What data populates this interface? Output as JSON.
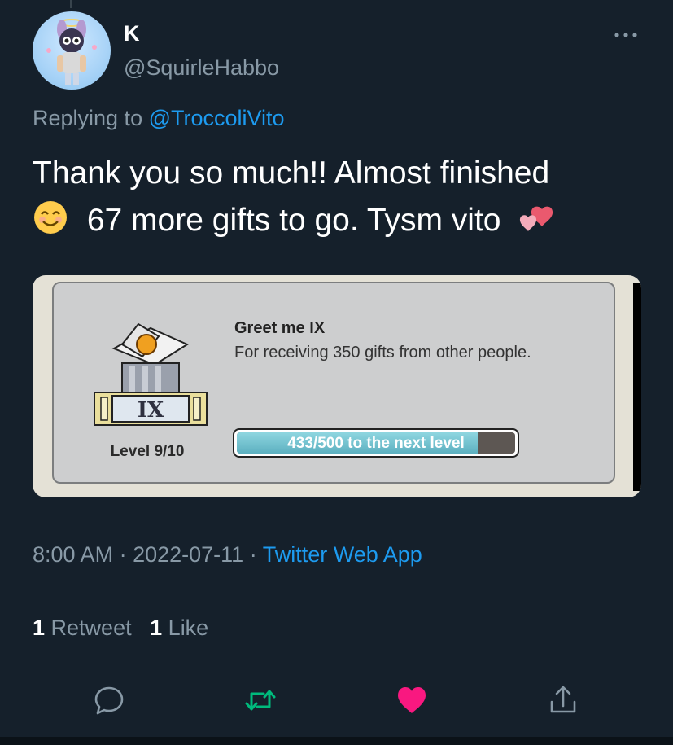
{
  "user": {
    "name": "K",
    "handle": "@SquirleHabbo"
  },
  "reply": {
    "prefix": "Replying to",
    "to": "@TroccoliVito"
  },
  "tweet": {
    "line1": "Thank you so much!! Almost finished",
    "line2": "67 more gifts to go. Tysm vito"
  },
  "achievement": {
    "title": "Greet me IX",
    "description": "For receiving 350 gifts from other people.",
    "level": "Level 9/10",
    "badge_numeral": "IX",
    "progress_text": "433/500 to the next level",
    "progress_value": 433,
    "progress_max": 500
  },
  "meta": {
    "time": "8:00 AM",
    "date": "2022-07-11",
    "app": "Twitter Web App"
  },
  "stats": {
    "retweets": "1",
    "retweet_label": "Retweet",
    "likes": "1",
    "like_label": "Like"
  },
  "icons": {
    "more": "more-icon",
    "reply": "reply-icon",
    "retweet": "retweet-icon",
    "like": "like-icon",
    "share": "share-icon"
  },
  "colors": {
    "accent": "#1d9bf0",
    "like": "#f91880",
    "retweet": "#00ba7c",
    "background": "#15202b"
  }
}
